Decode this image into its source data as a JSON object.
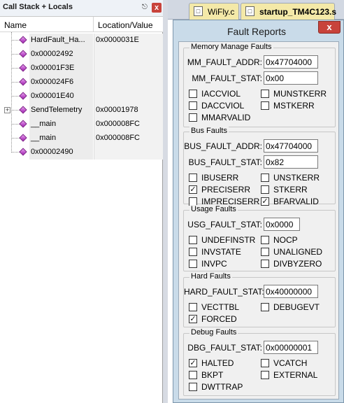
{
  "callstack": {
    "title": "Call Stack + Locals",
    "pin_icon": "pin-icon",
    "close_label": "x",
    "columns": {
      "name": "Name",
      "location": "Location/Value"
    },
    "rows": [
      {
        "name": "HardFault_Ha...",
        "location": "0x0000031E"
      },
      {
        "name": "0x00002492",
        "location": ""
      },
      {
        "name": "0x00001F3E",
        "location": ""
      },
      {
        "name": "0x000024F6",
        "location": ""
      },
      {
        "name": "0x00001E40",
        "location": ""
      },
      {
        "name": "SendTelemetry",
        "location": "0x00001978",
        "expander": "+"
      },
      {
        "name": "__main",
        "location": "0x000008FC"
      },
      {
        "name": "__main",
        "location": "0x000008FC"
      },
      {
        "name": "0x00002490",
        "location": ""
      }
    ]
  },
  "editor": {
    "tabs": [
      {
        "label": "WiFly.c"
      },
      {
        "label": "startup_TM4C123.s"
      }
    ]
  },
  "dialog": {
    "title": "Fault Reports",
    "close_label": "x",
    "groups": {
      "memory": {
        "title": "Memory Manage Faults",
        "fields": [
          {
            "label": "MM_FAULT_ADDR:",
            "value": "0x47704000"
          },
          {
            "label": "MM_FAULT_STAT:",
            "value": "0x00"
          }
        ],
        "checks": [
          {
            "label": "IACCVIOL",
            "checked": false
          },
          {
            "label": "MUNSTKERR",
            "checked": false
          },
          {
            "label": "DACCVIOL",
            "checked": false
          },
          {
            "label": "MSTKERR",
            "checked": false
          },
          {
            "label": "MMARVALID",
            "checked": false
          }
        ]
      },
      "bus": {
        "title": "Bus Faults",
        "fields": [
          {
            "label": "BUS_FAULT_ADDR:",
            "value": "0x47704000"
          },
          {
            "label": "BUS_FAULT_STAT:",
            "value": "0x82"
          }
        ],
        "checks": [
          {
            "label": "IBUSERR",
            "checked": false
          },
          {
            "label": "UNSTKERR",
            "checked": false
          },
          {
            "label": "PRECISERR",
            "checked": true
          },
          {
            "label": "STKERR",
            "checked": false
          },
          {
            "label": "IMPRECISERR",
            "checked": false
          },
          {
            "label": "BFARVALID",
            "checked": true
          }
        ]
      },
      "usage": {
        "title": "Usage Faults",
        "fields": [
          {
            "label": "USG_FAULT_STAT:",
            "value": "0x0000"
          }
        ],
        "checks": [
          {
            "label": "UNDEFINSTR",
            "checked": false
          },
          {
            "label": "NOCP",
            "checked": false
          },
          {
            "label": "INVSTATE",
            "checked": false
          },
          {
            "label": "UNALIGNED",
            "checked": false
          },
          {
            "label": "INVPC",
            "checked": false
          },
          {
            "label": "DIVBYZERO",
            "checked": false
          }
        ]
      },
      "hard": {
        "title": "Hard Faults",
        "fields": [
          {
            "label": "HARD_FAULT_STAT:",
            "value": "0x40000000"
          }
        ],
        "checks": [
          {
            "label": "VECTTBL",
            "checked": false
          },
          {
            "label": "DEBUGEVT",
            "checked": false
          },
          {
            "label": "FORCED",
            "checked": true
          }
        ]
      },
      "debug": {
        "title": "Debug Faults",
        "fields": [
          {
            "label": "DBG_FAULT_STAT:",
            "value": "0x00000001"
          }
        ],
        "checks": [
          {
            "label": "HALTED",
            "checked": true
          },
          {
            "label": "VCATCH",
            "checked": false
          },
          {
            "label": "BKPT",
            "checked": false
          },
          {
            "label": "EXTERNAL",
            "checked": false
          },
          {
            "label": "DWTTRAP",
            "checked": false
          }
        ]
      }
    }
  }
}
